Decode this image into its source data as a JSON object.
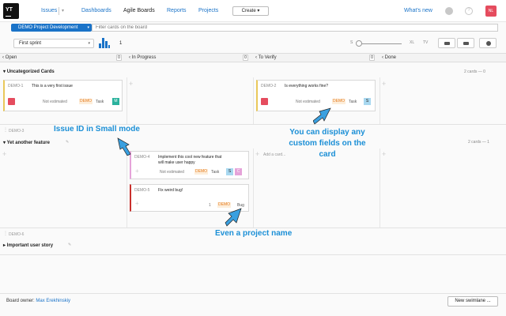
{
  "header": {
    "logo_text": "YT",
    "nav": [
      "Issues",
      "Dashboards",
      "Agile Boards",
      "Reports",
      "Projects"
    ],
    "create_label": "Create ▾",
    "whats_new": "What's new",
    "user_initials": "NL"
  },
  "search": {
    "project": "DEMO Project Development",
    "placeholder": "Filter cards on the board"
  },
  "toolbar": {
    "sprint": "First sprint",
    "sprint_count": "1",
    "size_small": "S",
    "size_xl": "XL",
    "size_tv": "TV"
  },
  "columns": [
    {
      "name": "Open",
      "count": "0"
    },
    {
      "name": "In Progress",
      "count": "0"
    },
    {
      "name": "To Verify",
      "count": "0"
    },
    {
      "name": "Done",
      "count": ""
    }
  ],
  "lanes": [
    {
      "id": "",
      "title": "Uncategorized Cards",
      "cards_info": "2 cards — 0"
    },
    {
      "id": "DEMO-3",
      "title": "Yet another feature",
      "cards_info": "2 cards — 1"
    },
    {
      "id": "DEMO-6",
      "title": "Important user story",
      "cards_info": ""
    }
  ],
  "cards": {
    "demo1": {
      "id": "DEMO-1",
      "summary": "This is a very first issue",
      "estimate": "Not estimated",
      "project": "DEMO",
      "type": "Task",
      "badge": "M"
    },
    "demo2": {
      "id": "DEMO-2",
      "summary": "Is everything works fine?",
      "estimate": "Not estimated",
      "project": "DEMO",
      "type": "Task",
      "badge": "S"
    },
    "demo4": {
      "id": "DEMO-4",
      "summary_line1": "Implement this cool new feature that",
      "summary_line2": "will make user happy",
      "estimate": "Not estimated",
      "project": "DEMO",
      "type": "Task",
      "badge1": "S",
      "badge2": "C"
    },
    "demo5": {
      "id": "DEMO-5",
      "summary": "Fix weird bug!",
      "estimate": "1",
      "project": "DEMO",
      "type": "Bug"
    }
  },
  "add_card": "Add a card...",
  "callouts": {
    "small_mode": "Issue ID in Small mode",
    "custom_fields_1": "You can display any",
    "custom_fields_2": "custom fields on the",
    "custom_fields_3": "card",
    "project_name": "Even a project name"
  },
  "footer": {
    "owner_label": "Board owner:",
    "owner_name": "Max Erekhinskiy",
    "new_swimlane": "New swimlane ..."
  },
  "colors": {
    "accent": "#1a73c8",
    "callout": "#1b8fd6",
    "project_tag": "#e67e22",
    "badge_teal": "#2bb29d",
    "badge_blue": "#a8d8f0",
    "badge_pink": "#e5a3d9"
  }
}
